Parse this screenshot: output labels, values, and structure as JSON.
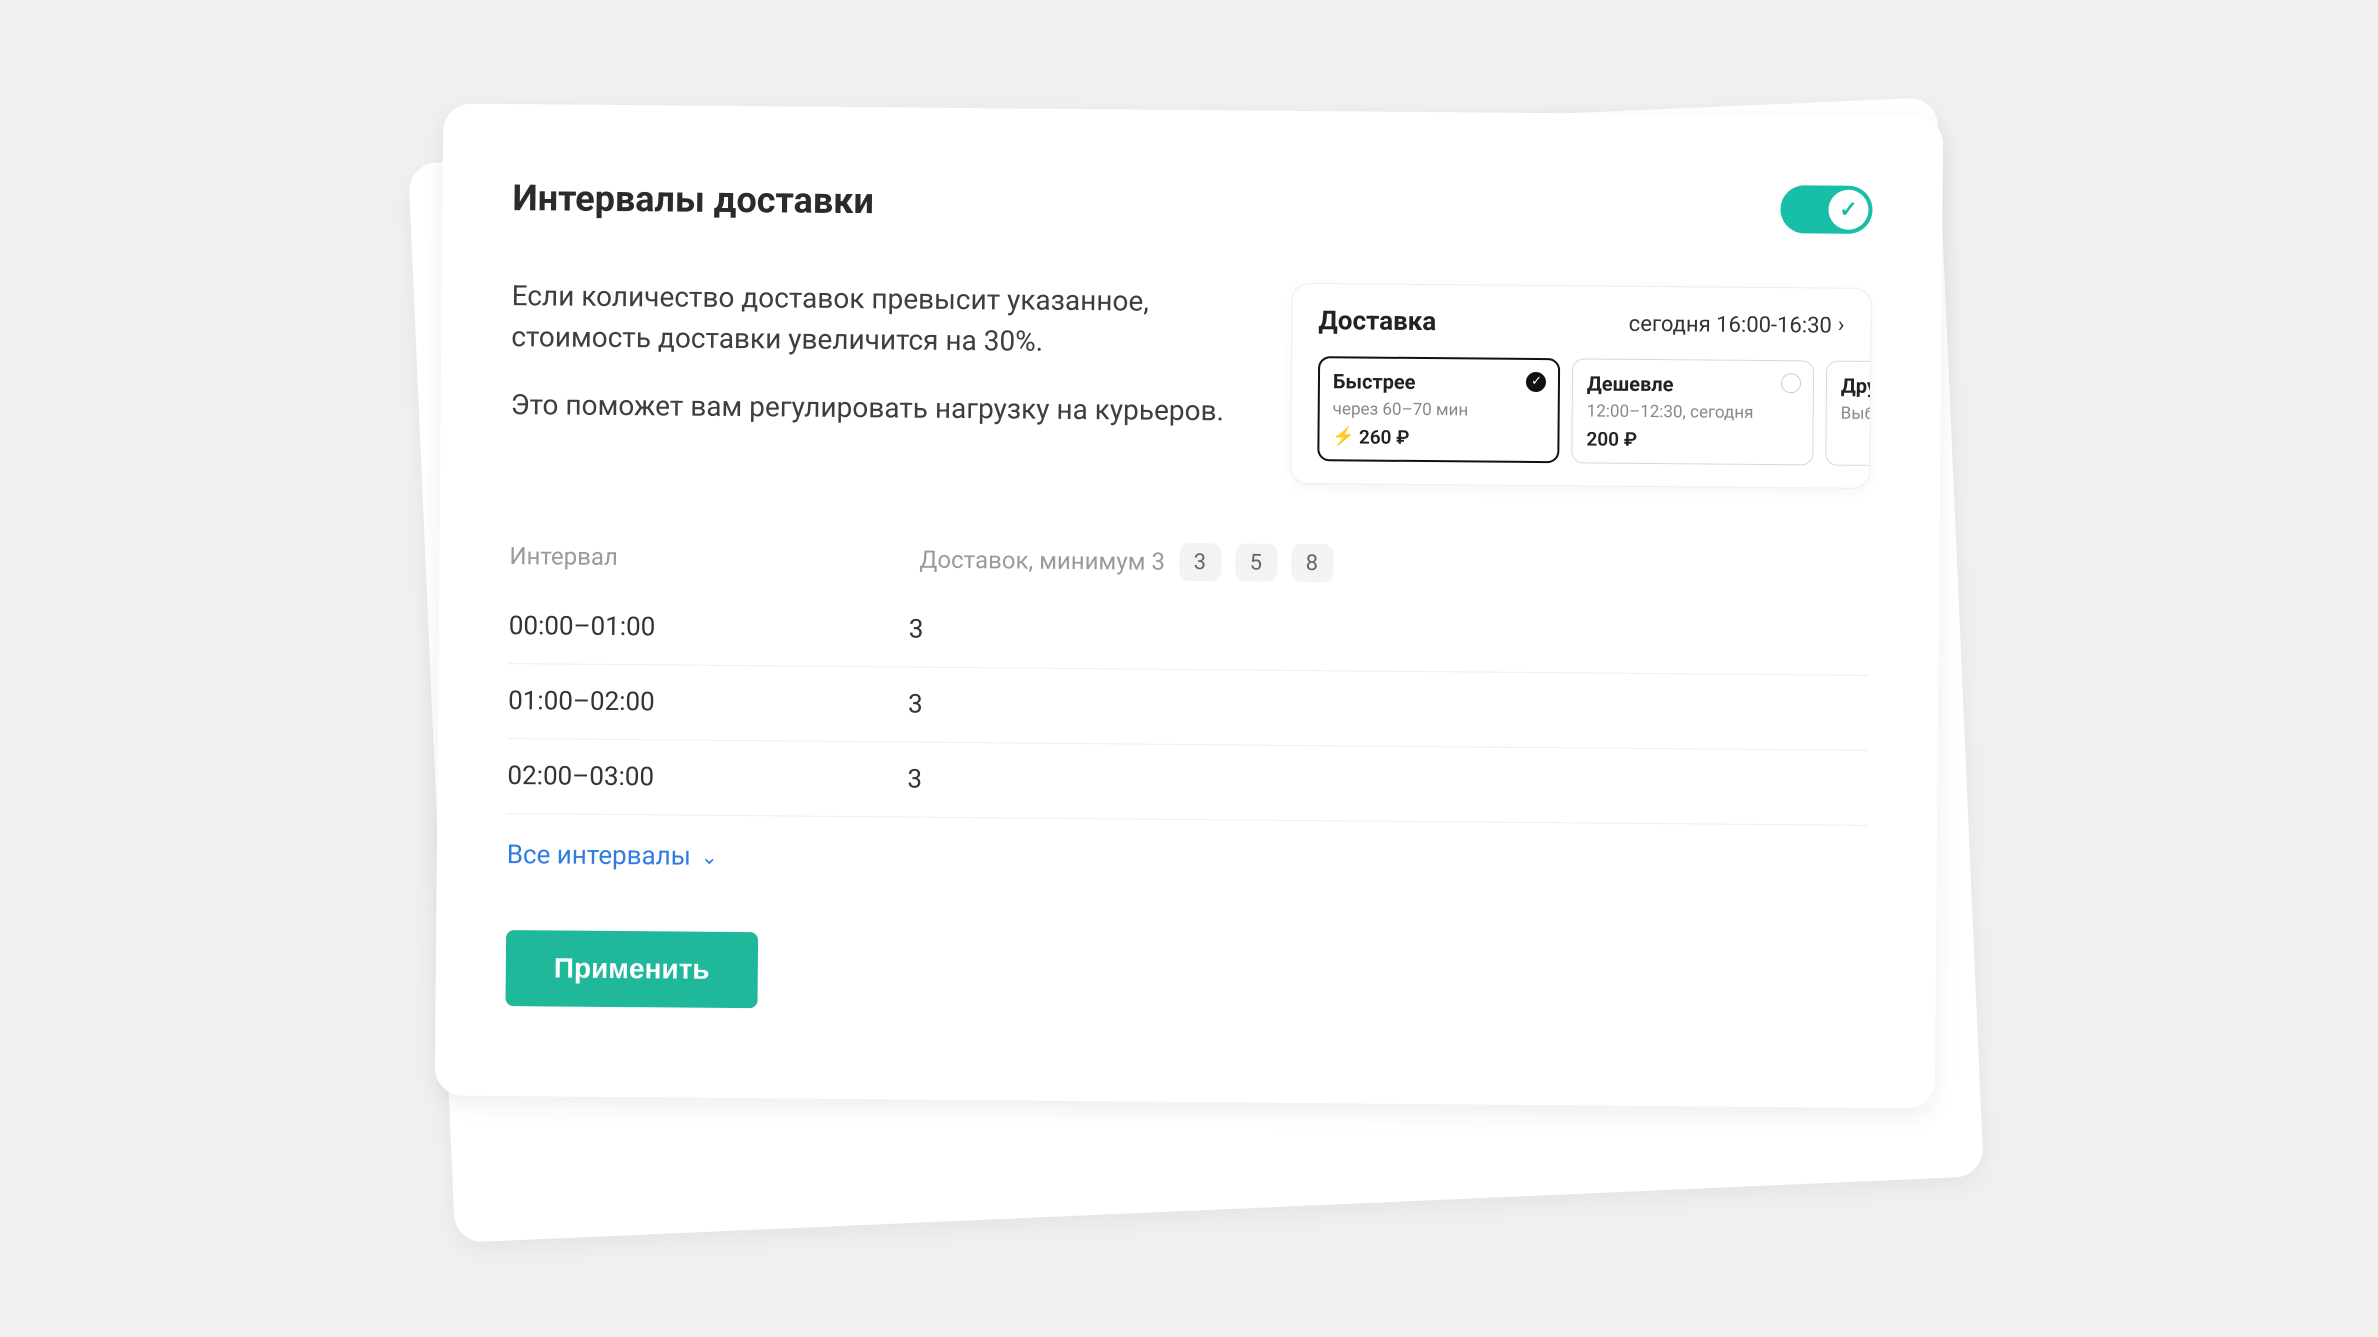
{
  "title": "Интервалы доставки",
  "desc": {
    "p1": "Если количество доставок превысит указанное, стоимость доставки увеличится на 30%.",
    "p2": "Это поможет вам регулировать нагрузку на курьеров."
  },
  "preview": {
    "title": "Доставка",
    "slot": "сегодня 16:00-16:30",
    "options": [
      {
        "title": "Быстрее",
        "sub": "через 60–70 мин",
        "price": "260 ₽",
        "selected": true,
        "bolt": true
      },
      {
        "title": "Дешевле",
        "sub": "12:00–12:30, сегодня",
        "price": "200 ₽",
        "selected": false,
        "bolt": false
      },
      {
        "title": "Дру",
        "sub": "Выб и вр",
        "price": "",
        "selected": false,
        "bolt": false
      }
    ]
  },
  "table": {
    "head_interval": "Интервал",
    "head_deliveries": "Доставок, минимум 3",
    "chips": [
      "3",
      "5",
      "8"
    ],
    "rows": [
      {
        "interval": "00:00–01:00",
        "value": "3"
      },
      {
        "interval": "01:00–02:00",
        "value": "3"
      },
      {
        "interval": "02:00–03:00",
        "value": "3"
      }
    ],
    "expand_label": "Все интервалы"
  },
  "apply_label": "Применить"
}
